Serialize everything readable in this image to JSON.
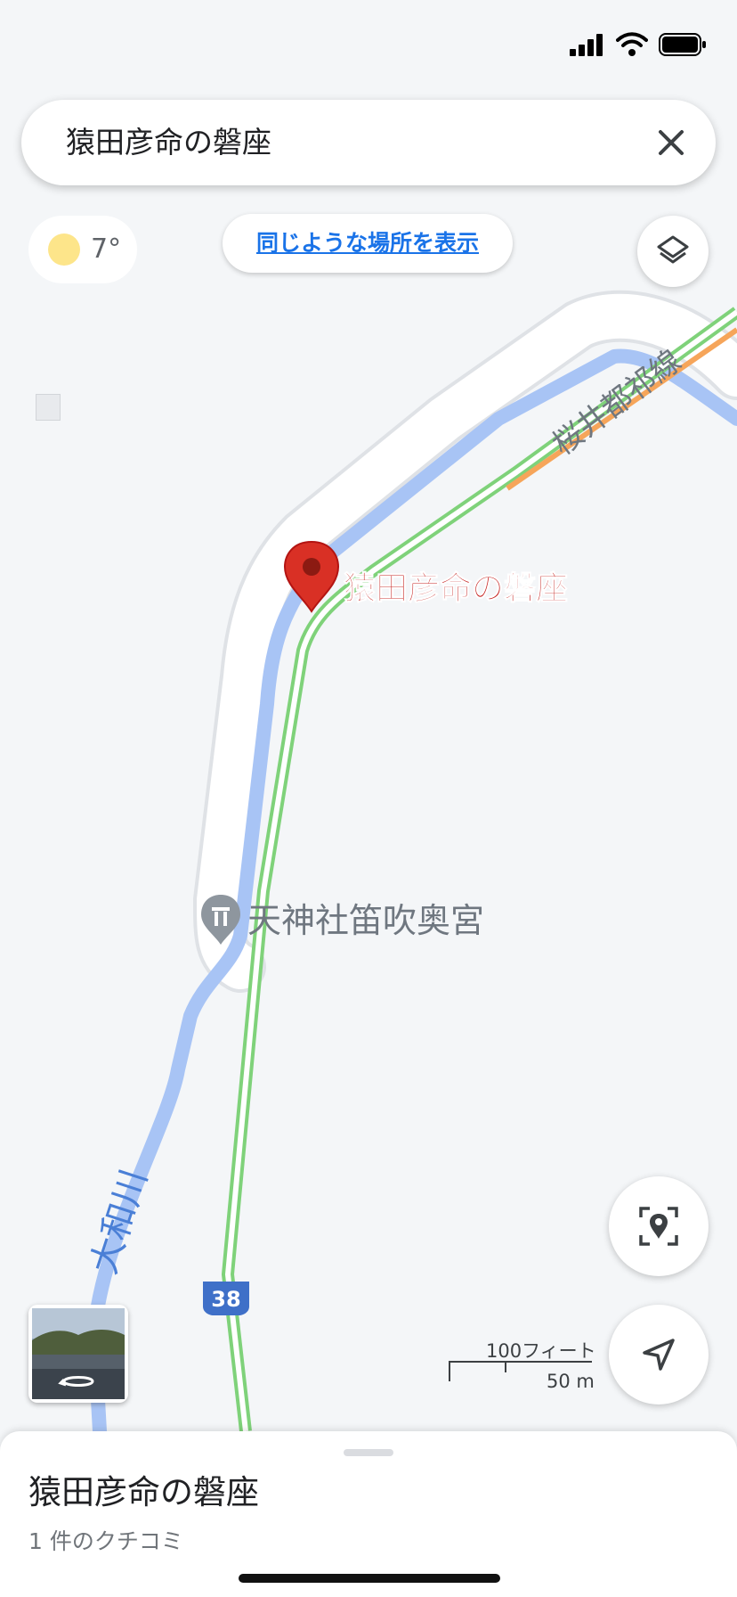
{
  "search": {
    "query": "猿田彦命の磐座"
  },
  "weather": {
    "temperature": "7°"
  },
  "similar_places_button": "同じような場所を表示",
  "map_labels": {
    "place_marker": "猿田彦命の磐座",
    "shrine": "天神社笛吹奥宮",
    "road": "桜井都祁線",
    "river": "大和川",
    "route_shield": "38"
  },
  "scale": {
    "imperial": "100フィート",
    "metric": "50 m"
  },
  "bottom_sheet": {
    "title": "猿田彦命の磐座",
    "subtitle": "1 件のクチコミ"
  },
  "colors": {
    "water": "#a8c4f5",
    "route_green": "#7fd27a",
    "route_orange": "#f6a55a",
    "marker_red": "#d93025",
    "label_red": "#c5221f",
    "road_white": "#ffffff",
    "shield_blue": "#3f70c8"
  }
}
